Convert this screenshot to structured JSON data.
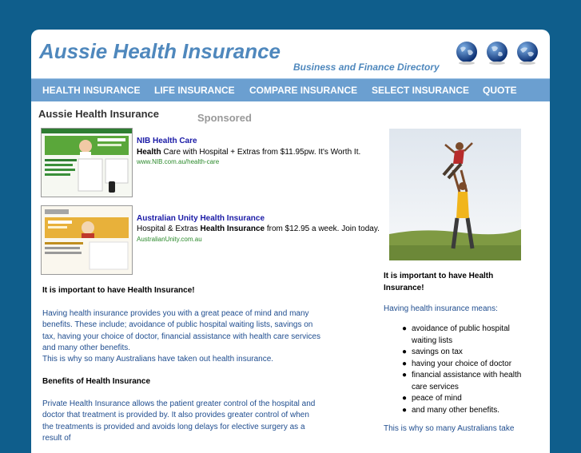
{
  "header": {
    "title": "Aussie Health Insurance",
    "tagline": "Business and Finance Directory",
    "icons": [
      "globe-icon",
      "globe-icon",
      "globe-icon"
    ]
  },
  "nav": {
    "items": [
      {
        "label": "HEALTH INSURANCE"
      },
      {
        "label": "LIFE INSURANCE"
      },
      {
        "label": "COMPARE INSURANCE"
      },
      {
        "label": "SELECT INSURANCE"
      },
      {
        "label": "QUOTE"
      }
    ]
  },
  "content": {
    "title": "Aussie Health Insurance",
    "sponsored": "Sponsored"
  },
  "ads": [
    {
      "title": "NIB Health Care",
      "desc_bold": "Health",
      "desc_rest": " Care with Hospital + Extras from $11.95pw. It's Worth It.",
      "url": "www.NIB.com.au/health-care"
    },
    {
      "title": "Australian Unity Health Insurance",
      "desc_pre": "Hospital & Extras ",
      "desc_bold": "Health Insurance",
      "desc_post": " from $12.95 a week. Join today.",
      "url": "AustralianUnity.com.au"
    }
  ],
  "main": {
    "heading1": "It is important to have Health Insurance!",
    "para1": "Having health insurance provides you with a great peace of mind and many benefits. These include; avoidance of public hospital waiting lists, savings on tax, having your choice of doctor, financial assistance with health care services and many other benefits.",
    "para1_last": "This is why so many Australians have taken out health insurance.",
    "heading2": "Benefits of Health Insurance",
    "para2": "Private Health Insurance allows the patient greater control of the hospital and doctor that treatment is provided by. It also provides greater control of when the treatments is provided and avoids long delays for elective surgery as a result of"
  },
  "sidebar": {
    "heading": "It is important to have Health Insurance!",
    "intro": "Having health insurance means:",
    "bullet_glyph": "●",
    "items": [
      "avoidance of public hospital waiting lists",
      "savings on tax",
      "having your choice of doctor",
      "financial assistance with health care services",
      "peace of mind",
      "and many other benefits."
    ],
    "footer": "This is why so many Australians take"
  },
  "colors": {
    "background": "#0f5e8c",
    "nav": "#6b9fd0",
    "title": "#4f88bd",
    "link": "#1a1aa6",
    "body_text": "#1f4d8f",
    "url": "#2b8a2b"
  }
}
